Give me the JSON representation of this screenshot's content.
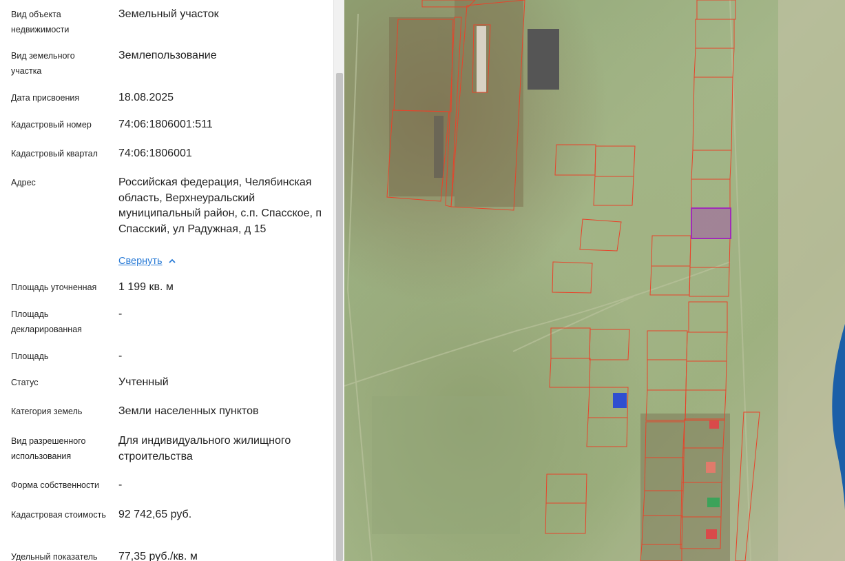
{
  "attributes": [
    {
      "label": "Вид объекта недвижимости",
      "value": "Земельный участок"
    },
    {
      "label": "Вид земельного участка",
      "value": "Землепользование"
    },
    {
      "label": "Дата присвоения",
      "value": "18.08.2025"
    },
    {
      "label": "Кадастровый номер",
      "value": "74:06:1806001:511"
    },
    {
      "label": "Кадастровый квартал",
      "value": "74:06:1806001"
    },
    {
      "label": "Адрес",
      "value": "Российская федерация, Челябинская область, Верхнеуральский муниципальный район, с.п. Спасское, п Спасский, ул Радужная, д 15"
    },
    {
      "label": "Площадь уточненная",
      "value": "1 199 кв. м"
    },
    {
      "label": "Площадь декларированная",
      "value": "-"
    },
    {
      "label": "Площадь",
      "value": "-"
    },
    {
      "label": "Статус",
      "value": "Учтенный"
    },
    {
      "label": "Категория земель",
      "value": "Земли населенных пунктов"
    },
    {
      "label": "Вид разрешенного использования",
      "value": "Для индивидуального жилищного строительства"
    },
    {
      "label": "Форма собственности",
      "value": "-"
    },
    {
      "label": "Кадастровая стоимость",
      "value": "92 742,65 руб."
    },
    {
      "label": "Удельный показатель",
      "value": "77,35 руб./кв. м"
    }
  ],
  "address_toggle": {
    "label": "Свернуть",
    "icon": "chevron-up-icon"
  },
  "colors": {
    "parcel_outline": "#e8432a",
    "selected_parcel": "#a02bb8",
    "link": "#2a7bd6"
  }
}
